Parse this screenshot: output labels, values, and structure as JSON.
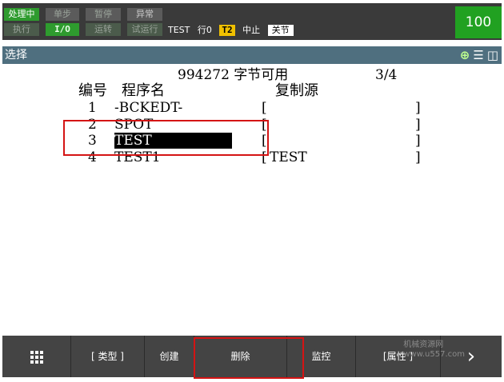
{
  "status": {
    "row1": [
      "处理中",
      "单步",
      "暂停",
      "异常"
    ],
    "row2": [
      "执行",
      "I/O",
      "运转",
      "试运行"
    ],
    "program": "TEST",
    "line": "行0",
    "mode": "T2",
    "state": "中止",
    "coord": "关节",
    "speed": "100"
  },
  "title": {
    "label": "选择",
    "icons": [
      "zoom-icon",
      "menu-icon",
      "split-view-icon"
    ]
  },
  "header": {
    "memory": "994272 字节可用",
    "page": "3/4",
    "col_no": "编号",
    "col_name": "程序名",
    "col_copy": "复制源"
  },
  "programs": [
    {
      "no": "1",
      "name": "-BCKEDT-",
      "copy_open": "[",
      "copy_src": "",
      "copy_close": "]"
    },
    {
      "no": "2",
      "name": "SPOT",
      "copy_open": "[",
      "copy_src": "",
      "copy_close": "]"
    },
    {
      "no": "3",
      "name": "TEST",
      "copy_open": "[",
      "copy_src": "",
      "copy_close": "]"
    },
    {
      "no": "4",
      "name": "TEST1",
      "copy_open": "[",
      "copy_src": "TEST",
      "copy_close": "]"
    }
  ],
  "fkeys": {
    "menu": "grid-icon",
    "type": "[ 类型 ]",
    "create": "创建",
    "delete": "删除",
    "monitor": "监控",
    "attr": "[属性 ]",
    "next": "›"
  },
  "watermark": {
    "line1": "机械资源网",
    "line2": "www.u557.com"
  },
  "colors": {
    "status_bg": "#3a3a3a",
    "speed_bg": "#21a121",
    "title_bg": "#4f6f7f",
    "fkey_bg": "#444444",
    "annotation_red": "#d41414"
  }
}
